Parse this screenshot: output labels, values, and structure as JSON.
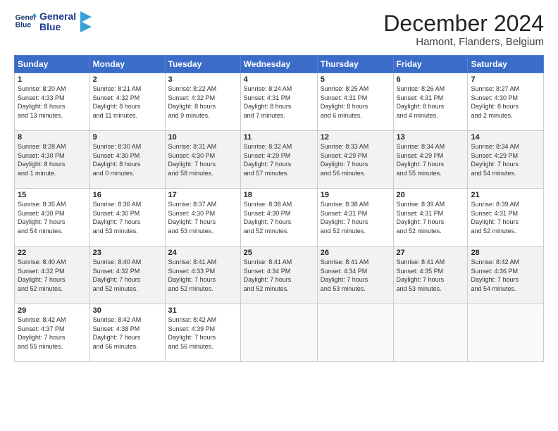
{
  "header": {
    "logo_line1": "General",
    "logo_line2": "Blue",
    "month": "December 2024",
    "location": "Hamont, Flanders, Belgium"
  },
  "days_of_week": [
    "Sunday",
    "Monday",
    "Tuesday",
    "Wednesday",
    "Thursday",
    "Friday",
    "Saturday"
  ],
  "weeks": [
    [
      {
        "day": "1",
        "info": "Sunrise: 8:20 AM\nSunset: 4:33 PM\nDaylight: 8 hours\nand 13 minutes."
      },
      {
        "day": "2",
        "info": "Sunrise: 8:21 AM\nSunset: 4:32 PM\nDaylight: 8 hours\nand 11 minutes."
      },
      {
        "day": "3",
        "info": "Sunrise: 8:22 AM\nSunset: 4:32 PM\nDaylight: 8 hours\nand 9 minutes."
      },
      {
        "day": "4",
        "info": "Sunrise: 8:24 AM\nSunset: 4:31 PM\nDaylight: 8 hours\nand 7 minutes."
      },
      {
        "day": "5",
        "info": "Sunrise: 8:25 AM\nSunset: 4:31 PM\nDaylight: 8 hours\nand 6 minutes."
      },
      {
        "day": "6",
        "info": "Sunrise: 8:26 AM\nSunset: 4:31 PM\nDaylight: 8 hours\nand 4 minutes."
      },
      {
        "day": "7",
        "info": "Sunrise: 8:27 AM\nSunset: 4:30 PM\nDaylight: 8 hours\nand 2 minutes."
      }
    ],
    [
      {
        "day": "8",
        "info": "Sunrise: 8:28 AM\nSunset: 4:30 PM\nDaylight: 8 hours\nand 1 minute."
      },
      {
        "day": "9",
        "info": "Sunrise: 8:30 AM\nSunset: 4:30 PM\nDaylight: 8 hours\nand 0 minutes."
      },
      {
        "day": "10",
        "info": "Sunrise: 8:31 AM\nSunset: 4:30 PM\nDaylight: 7 hours\nand 58 minutes."
      },
      {
        "day": "11",
        "info": "Sunrise: 8:32 AM\nSunset: 4:29 PM\nDaylight: 7 hours\nand 57 minutes."
      },
      {
        "day": "12",
        "info": "Sunrise: 8:33 AM\nSunset: 4:29 PM\nDaylight: 7 hours\nand 56 minutes."
      },
      {
        "day": "13",
        "info": "Sunrise: 8:34 AM\nSunset: 4:29 PM\nDaylight: 7 hours\nand 55 minutes."
      },
      {
        "day": "14",
        "info": "Sunrise: 8:34 AM\nSunset: 4:29 PM\nDaylight: 7 hours\nand 54 minutes."
      }
    ],
    [
      {
        "day": "15",
        "info": "Sunrise: 8:35 AM\nSunset: 4:30 PM\nDaylight: 7 hours\nand 54 minutes."
      },
      {
        "day": "16",
        "info": "Sunrise: 8:36 AM\nSunset: 4:30 PM\nDaylight: 7 hours\nand 53 minutes."
      },
      {
        "day": "17",
        "info": "Sunrise: 8:37 AM\nSunset: 4:30 PM\nDaylight: 7 hours\nand 53 minutes."
      },
      {
        "day": "18",
        "info": "Sunrise: 8:38 AM\nSunset: 4:30 PM\nDaylight: 7 hours\nand 52 minutes."
      },
      {
        "day": "19",
        "info": "Sunrise: 8:38 AM\nSunset: 4:31 PM\nDaylight: 7 hours\nand 52 minutes."
      },
      {
        "day": "20",
        "info": "Sunrise: 8:39 AM\nSunset: 4:31 PM\nDaylight: 7 hours\nand 52 minutes."
      },
      {
        "day": "21",
        "info": "Sunrise: 8:39 AM\nSunset: 4:31 PM\nDaylight: 7 hours\nand 52 minutes."
      }
    ],
    [
      {
        "day": "22",
        "info": "Sunrise: 8:40 AM\nSunset: 4:32 PM\nDaylight: 7 hours\nand 52 minutes."
      },
      {
        "day": "23",
        "info": "Sunrise: 8:40 AM\nSunset: 4:32 PM\nDaylight: 7 hours\nand 52 minutes."
      },
      {
        "day": "24",
        "info": "Sunrise: 8:41 AM\nSunset: 4:33 PM\nDaylight: 7 hours\nand 52 minutes."
      },
      {
        "day": "25",
        "info": "Sunrise: 8:41 AM\nSunset: 4:34 PM\nDaylight: 7 hours\nand 52 minutes."
      },
      {
        "day": "26",
        "info": "Sunrise: 8:41 AM\nSunset: 4:34 PM\nDaylight: 7 hours\nand 53 minutes."
      },
      {
        "day": "27",
        "info": "Sunrise: 8:41 AM\nSunset: 4:35 PM\nDaylight: 7 hours\nand 53 minutes."
      },
      {
        "day": "28",
        "info": "Sunrise: 8:42 AM\nSunset: 4:36 PM\nDaylight: 7 hours\nand 54 minutes."
      }
    ],
    [
      {
        "day": "29",
        "info": "Sunrise: 8:42 AM\nSunset: 4:37 PM\nDaylight: 7 hours\nand 55 minutes."
      },
      {
        "day": "30",
        "info": "Sunrise: 8:42 AM\nSunset: 4:38 PM\nDaylight: 7 hours\nand 56 minutes."
      },
      {
        "day": "31",
        "info": "Sunrise: 8:42 AM\nSunset: 4:39 PM\nDaylight: 7 hours\nand 56 minutes."
      },
      null,
      null,
      null,
      null
    ]
  ]
}
